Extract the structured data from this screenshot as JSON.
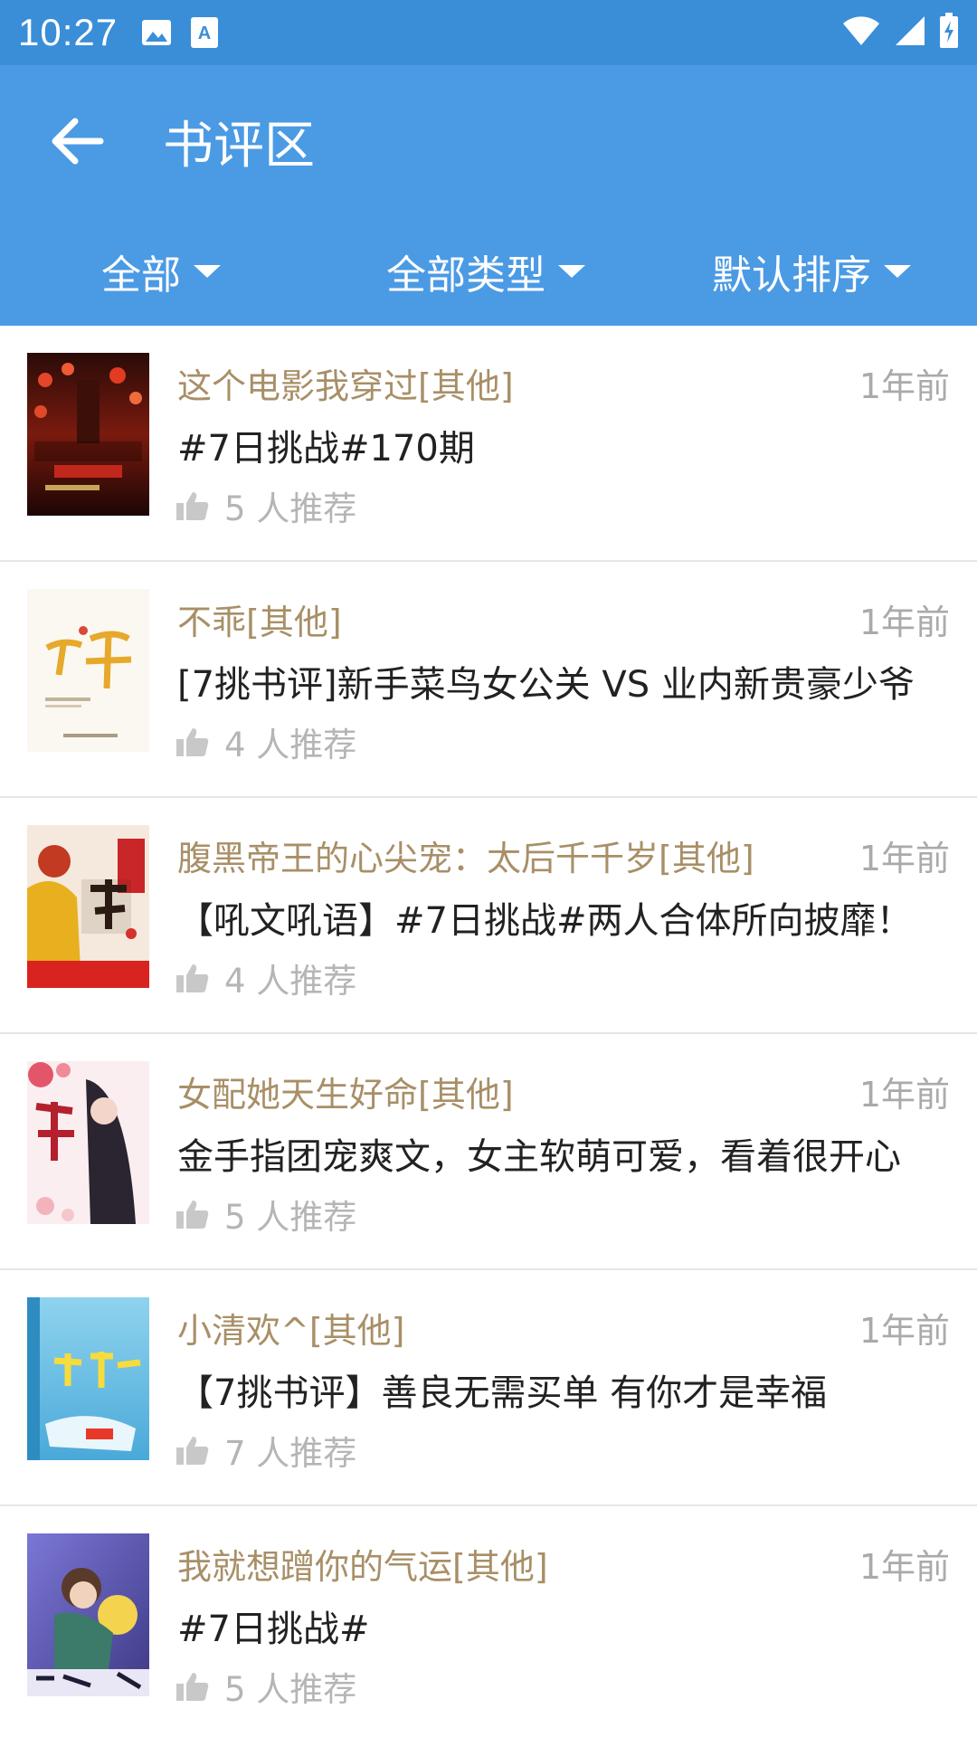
{
  "status_bar": {
    "time": "10:27"
  },
  "app_bar": {
    "title": "书评区"
  },
  "filters": [
    {
      "label": "全部"
    },
    {
      "label": "全部类型"
    },
    {
      "label": "默认排序"
    }
  ],
  "reviews": [
    {
      "book": "这个电影我穿过[其他]",
      "time": "1年前",
      "review": "#7日挑战#170期",
      "recommend": "5 人推荐"
    },
    {
      "book": "不乖[其他]",
      "time": "1年前",
      "review": "[7挑书评]新手菜鸟女公关 VS 业内新贵豪少爷",
      "recommend": "4 人推荐"
    },
    {
      "book": "腹黑帝王的心尖宠：太后千千岁[其他]",
      "time": "1年前",
      "review": "【吼文吼语】#7日挑战#两人合体所向披靡！",
      "recommend": "4 人推荐"
    },
    {
      "book": "女配她天生好命[其他]",
      "time": "1年前",
      "review": "金手指团宠爽文，女主软萌可爱，看着很开心",
      "recommend": "5 人推荐"
    },
    {
      "book": "小清欢^[其他]",
      "time": "1年前",
      "review": "【7挑书评】善良无需买单 有你才是幸福",
      "recommend": "7 人推荐"
    },
    {
      "book": "我就想蹭你的气运[其他]",
      "time": "1年前",
      "review": "#7日挑战#",
      "recommend": "5 人推荐"
    }
  ],
  "colors": {
    "status_bar": "#3a8ed8",
    "app_bar": "#4b9ae4",
    "book_title": "#a88f67",
    "muted": "#aaaaaa"
  }
}
